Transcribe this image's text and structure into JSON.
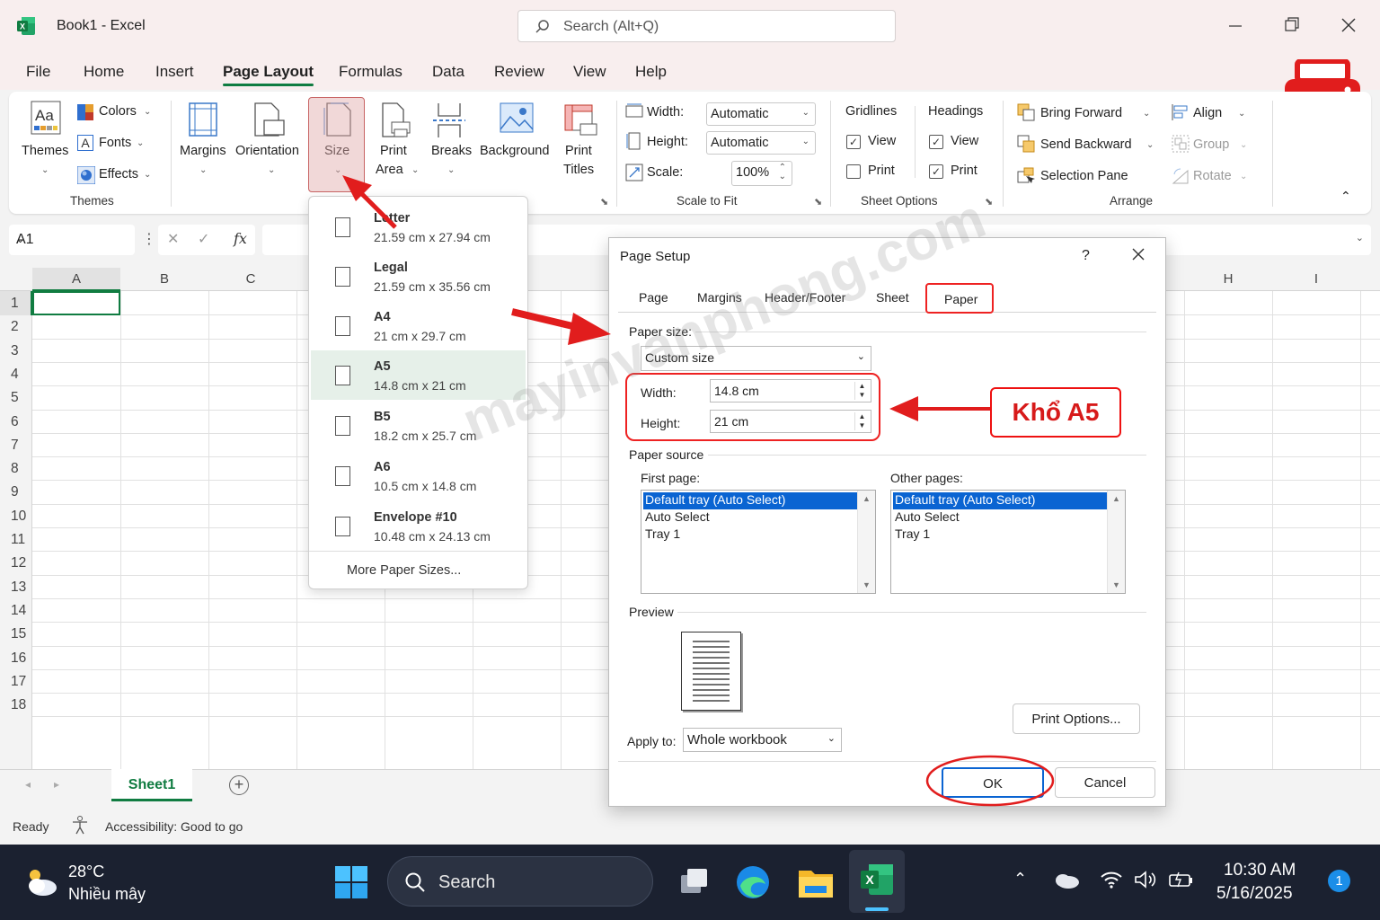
{
  "window": {
    "title": "Book1  -  Excel",
    "search_placeholder": "Search (Alt+Q)"
  },
  "menu": {
    "items": [
      "File",
      "Home",
      "Insert",
      "Page Layout",
      "Formulas",
      "Data",
      "Review",
      "View",
      "Help"
    ],
    "active": "Page Layout"
  },
  "ribbon": {
    "themes": {
      "themes_label": "Themes",
      "colors": "Colors",
      "fonts": "Fonts",
      "effects": "Effects",
      "group_label": "Themes"
    },
    "page_setup": {
      "margins": "Margins",
      "orientation": "Orientation",
      "size": "Size",
      "print_area_1": "Print",
      "print_area_2": "Area",
      "breaks": "Breaks",
      "background": "Background",
      "print_titles_1": "Print",
      "print_titles_2": "Titles"
    },
    "scale": {
      "width_label": "Width:",
      "width_value": "Automatic",
      "height_label": "Height:",
      "height_value": "Automatic",
      "scale_label": "Scale:",
      "scale_value": "100%",
      "group_label": "Scale to Fit"
    },
    "sheet_options": {
      "gridlines": "Gridlines",
      "headings": "Headings",
      "view": "View",
      "print": "Print",
      "gridlines_view": true,
      "gridlines_print": false,
      "headings_view": true,
      "headings_print": true,
      "group_label": "Sheet Options"
    },
    "arrange": {
      "bring_forward": "Bring Forward",
      "send_backward": "Send Backward",
      "selection_pane": "Selection Pane",
      "align": "Align",
      "group": "Group",
      "rotate": "Rotate",
      "group_label": "Arrange"
    }
  },
  "formula_bar": {
    "name_box": "A1",
    "fx": "fx"
  },
  "grid": {
    "columns": [
      "A",
      "B",
      "C",
      "H",
      "I"
    ],
    "rows": [
      "1",
      "2",
      "3",
      "4",
      "5",
      "6",
      "7",
      "8",
      "9",
      "10",
      "11",
      "12",
      "13",
      "14",
      "15",
      "16",
      "17",
      "18"
    ]
  },
  "sheets": {
    "tabs": [
      "Sheet1"
    ],
    "active": "Sheet1"
  },
  "status": {
    "ready": "Ready",
    "accessibility": "Accessibility: Good to go"
  },
  "size_menu": {
    "items": [
      {
        "name": "Letter",
        "dims": "21.59 cm x 27.94 cm"
      },
      {
        "name": "Legal",
        "dims": "21.59 cm x 35.56 cm"
      },
      {
        "name": "A4",
        "dims": "21 cm x 29.7 cm"
      },
      {
        "name": "A5",
        "dims": "14.8 cm x 21 cm"
      },
      {
        "name": "B5",
        "dims": "18.2 cm x 25.7 cm"
      },
      {
        "name": "A6",
        "dims": "10.5 cm x 14.8 cm"
      },
      {
        "name": "Envelope #10",
        "dims": "10.48 cm x 24.13 cm"
      }
    ],
    "selected": "A5",
    "more": "More Paper Sizes..."
  },
  "dialog": {
    "title": "Page Setup",
    "help": "?",
    "tabs": [
      "Page",
      "Margins",
      "Header/Footer",
      "Sheet",
      "Paper"
    ],
    "active_tab": "Paper",
    "paper_size_label": "Paper size:",
    "paper_size_value": "Custom size",
    "width_label": "Width:",
    "width_value": "14.8 cm",
    "height_label": "Height:",
    "height_value": "21 cm",
    "paper_source_label": "Paper source",
    "first_page_label": "First page:",
    "other_pages_label": "Other pages:",
    "first_page_items": [
      "Default tray (Auto Select)",
      "Auto Select",
      "Tray 1"
    ],
    "other_pages_items": [
      "Default tray (Auto Select)",
      "Auto Select",
      "Tray 1"
    ],
    "preview_label": "Preview",
    "print_options": "Print Options...",
    "apply_to_label": "Apply to:",
    "apply_to_value": "Whole workbook",
    "ok": "OK",
    "cancel": "Cancel"
  },
  "annotation": {
    "label": "Khổ A5",
    "watermark": "mayinvanphong.com"
  },
  "taskbar": {
    "weather_temp": "28°C",
    "weather_desc": "Nhiều mây",
    "search": "Search",
    "time": "10:30 AM",
    "date": "5/16/2025",
    "notifications": "1"
  },
  "colors": {
    "excel_green": "#107c41",
    "accent_red": "#e11d1d",
    "selection_blue": "#0a64d2"
  }
}
